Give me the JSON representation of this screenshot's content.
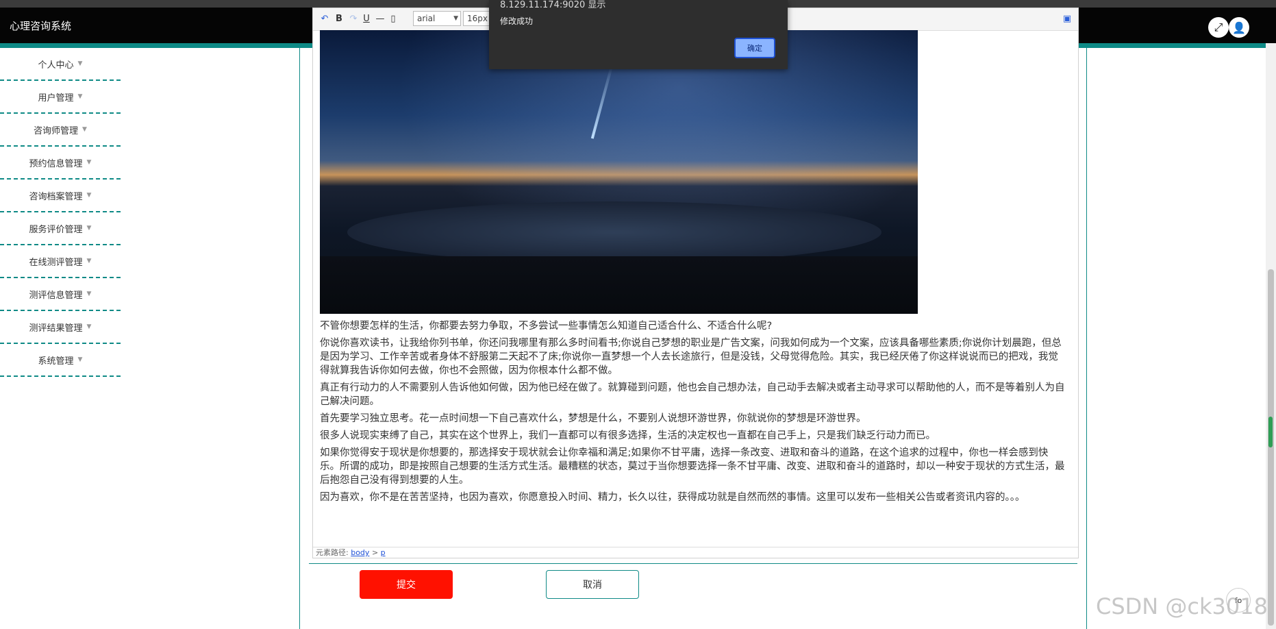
{
  "app": {
    "title": "心理咨询系统"
  },
  "header": {
    "fullscreen_icon": "expand-icon",
    "user_icon": "user-icon"
  },
  "sidebar": {
    "items": [
      {
        "label": "个人中心"
      },
      {
        "label": "用户管理"
      },
      {
        "label": "咨询师管理"
      },
      {
        "label": "预约信息管理"
      },
      {
        "label": "咨询档案管理"
      },
      {
        "label": "服务评价管理"
      },
      {
        "label": "在线测评管理"
      },
      {
        "label": "测评信息管理"
      },
      {
        "label": "测评结果管理"
      },
      {
        "label": "系统管理"
      }
    ]
  },
  "toolbar": {
    "bold": "B",
    "underline": "U",
    "hr": "—",
    "font_family": "arial",
    "font_size": "16px"
  },
  "article": {
    "paragraphs": [
      "不管你想要怎样的生活，你都要去努力争取，不多尝试一些事情怎么知道自己适合什么、不适合什么呢?",
      "你说你喜欢读书，让我给你列书单，你还问我哪里有那么多时间看书;你说自己梦想的职业是广告文案，问我如何成为一个文案，应该具备哪些素质;你说你计划晨跑，但总是因为学习、工作辛苦或者身体不舒服第二天起不了床;你说你一直梦想一个人去长途旅行，但是没钱，父母觉得危险。其实，我已经厌倦了你这样说说而已的把戏，我觉得就算我告诉你如何去做，你也不会照做，因为你根本什么都不做。",
      "真正有行动力的人不需要别人告诉他如何做，因为他已经在做了。就算碰到问题，他也会自己想办法，自己动手去解决或者主动寻求可以帮助他的人，而不是等着别人为自己解决问题。",
      "首先要学习独立思考。花一点时间想一下自己喜欢什么，梦想是什么，不要别人说想环游世界，你就说你的梦想是环游世界。",
      "很多人说现实束缚了自己，其实在这个世界上，我们一直都可以有很多选择，生活的决定权也一直都在自己手上，只是我们缺乏行动力而已。",
      "如果你觉得安于现状是你想要的，那选择安于现状就会让你幸福和满足;如果你不甘平庸，选择一条改变、进取和奋斗的道路，在这个追求的过程中，你也一样会感到快乐。所谓的成功，即是按照自己想要的生活方式生活。最糟糕的状态，莫过于当你想要选择一条不甘平庸、改变、进取和奋斗的道路时，却以一种安于现状的方式生活，最后抱怨自己没有得到想要的人生。",
      "因为喜欢，你不是在苦苦坚持，也因为喜欢，你愿意投入时间、精力，长久以往，获得成功就是自然而然的事情。这里可以发布一些相关公告或者资讯内容的。。。"
    ]
  },
  "element_path": {
    "label": "元素路径:",
    "body": "body",
    "sep": ">",
    "p": "p"
  },
  "form": {
    "submit": "提交",
    "cancel": "取消"
  },
  "dialog": {
    "title": "8.129.11.174:9020 显示",
    "message": "修改成功",
    "ok": "确定"
  },
  "watermark": "CSDN @ck3018",
  "float_button": "fο",
  "colors": {
    "accent": "#0e8a86",
    "submit": "#ff1100",
    "header": "#050505"
  }
}
